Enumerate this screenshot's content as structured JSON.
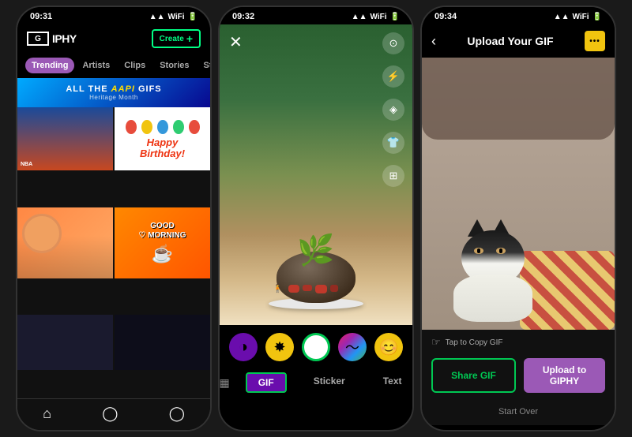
{
  "phones": [
    {
      "id": "phone1",
      "status_time": "09:31",
      "header": {
        "logo": "GIPHY",
        "create_label": "Create"
      },
      "nav_tabs": [
        {
          "label": "Trending",
          "active": true
        },
        {
          "label": "Artists",
          "active": false
        },
        {
          "label": "Clips",
          "active": false
        },
        {
          "label": "Stories",
          "active": false
        },
        {
          "label": "Stickers",
          "active": false
        }
      ],
      "banner": {
        "text_before": "ALL THE ",
        "highlight": "AAPI",
        "text_after": " GIFS",
        "sub": "Heritage Month"
      },
      "grid_items": [
        {
          "type": "sports",
          "label": ""
        },
        {
          "type": "birthday",
          "label": "Happy Birthday!"
        },
        {
          "type": "cat_orange",
          "label": ""
        },
        {
          "type": "good_morning",
          "label": "Good Morning"
        },
        {
          "type": "dark1",
          "label": ""
        },
        {
          "type": "dark2",
          "label": ""
        }
      ],
      "bottom_nav": [
        "home",
        "search",
        "profile"
      ]
    },
    {
      "id": "phone2",
      "status_time": "09:32",
      "tools": [
        "camera-flip",
        "flash",
        "filter",
        "timer",
        "expand"
      ],
      "stickers": [
        {
          "type": "purple",
          "icon": "◑"
        },
        {
          "type": "burst",
          "icon": "✸"
        },
        {
          "type": "white",
          "icon": "○"
        },
        {
          "type": "rainbow",
          "icon": "〜"
        },
        {
          "type": "emoji",
          "icon": "😊"
        }
      ],
      "modes": [
        {
          "label": "GIF",
          "active": true,
          "icon": "▦"
        },
        {
          "label": "Sticker",
          "active": false,
          "icon": ""
        },
        {
          "label": "Text",
          "active": false,
          "icon": ""
        }
      ]
    },
    {
      "id": "phone3",
      "status_time": "09:34",
      "header": {
        "back_icon": "‹",
        "title": "Upload Your GIF",
        "menu_icon": "•••"
      },
      "tap_to_copy": "Tap to Copy GIF",
      "buttons": {
        "share": "Share GIF",
        "upload": "Upload to GIPHY"
      },
      "start_over": "Start Over"
    }
  ],
  "icons": {
    "home": "⌂",
    "search": "○",
    "profile": "◯",
    "close": "✕",
    "back": "‹",
    "dots": "⋯",
    "tap": "☞"
  }
}
